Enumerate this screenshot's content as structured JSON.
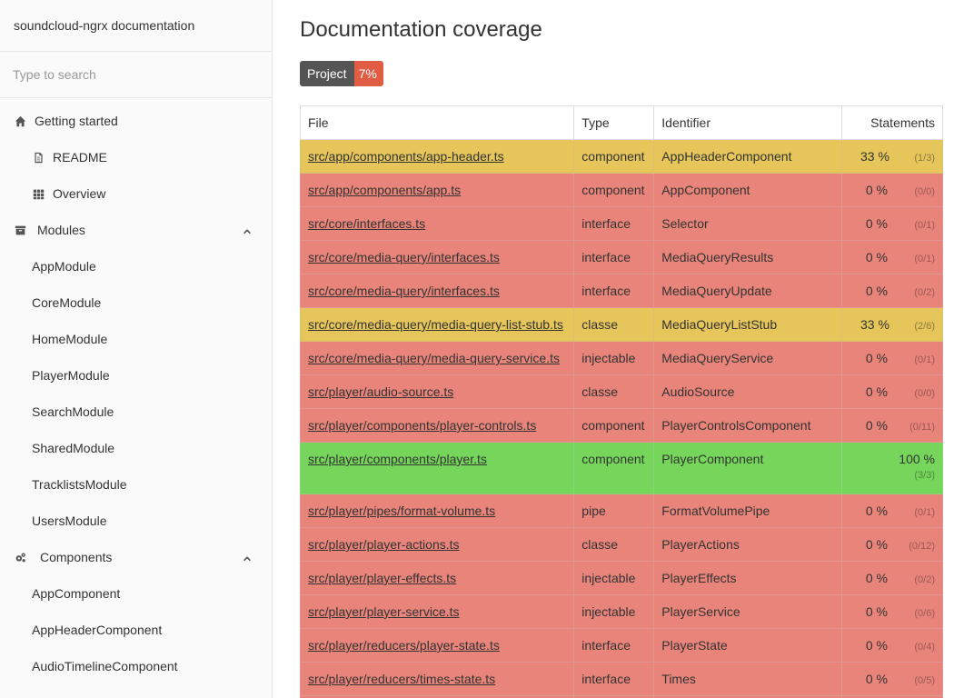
{
  "brand": "soundcloud-ngrx documentation",
  "search": {
    "placeholder": "Type to search"
  },
  "menu": {
    "getting_started": "Getting started",
    "readme": "README",
    "overview": "Overview",
    "modules": "Modules",
    "module_items": [
      "AppModule",
      "CoreModule",
      "HomeModule",
      "PlayerModule",
      "SearchModule",
      "SharedModule",
      "TracklistsModule",
      "UsersModule"
    ],
    "components": "Components",
    "component_items": [
      "AppComponent",
      "AppHeaderComponent",
      "AudioTimelineComponent"
    ]
  },
  "page": {
    "title": "Documentation coverage",
    "badge_label": "Project",
    "badge_value": "7%"
  },
  "table": {
    "headers": {
      "file": "File",
      "type": "Type",
      "identifier": "Identifier",
      "statements": "Statements"
    },
    "rows": [
      {
        "file": "src/app/components/app-header.ts",
        "type": "component",
        "identifier": "AppHeaderComponent",
        "pct": "33 %",
        "count": "(1/3)",
        "level": "med"
      },
      {
        "file": "src/app/components/app.ts",
        "type": "component",
        "identifier": "AppComponent",
        "pct": "0 %",
        "count": "(0/0)",
        "level": "low"
      },
      {
        "file": "src/core/interfaces.ts",
        "type": "interface",
        "identifier": "Selector",
        "pct": "0 %",
        "count": "(0/1)",
        "level": "low"
      },
      {
        "file": "src/core/media-query/interfaces.ts",
        "type": "interface",
        "identifier": "MediaQueryResults",
        "pct": "0 %",
        "count": "(0/1)",
        "level": "low"
      },
      {
        "file": "src/core/media-query/interfaces.ts",
        "type": "interface",
        "identifier": "MediaQueryUpdate",
        "pct": "0 %",
        "count": "(0/2)",
        "level": "low"
      },
      {
        "file": "src/core/media-query/media-query-list-stub.ts",
        "type": "classe",
        "identifier": "MediaQueryListStub",
        "pct": "33 %",
        "count": "(2/6)",
        "level": "med"
      },
      {
        "file": "src/core/media-query/media-query-service.ts",
        "type": "injectable",
        "identifier": "MediaQueryService",
        "pct": "0 %",
        "count": "(0/1)",
        "level": "low"
      },
      {
        "file": "src/player/audio-source.ts",
        "type": "classe",
        "identifier": "AudioSource",
        "pct": "0 %",
        "count": "(0/0)",
        "level": "low"
      },
      {
        "file": "src/player/components/player-controls.ts",
        "type": "component",
        "identifier": "PlayerControlsComponent",
        "pct": "0 %",
        "count": "(0/11)",
        "level": "low"
      },
      {
        "file": "src/player/components/player.ts",
        "type": "component",
        "identifier": "PlayerComponent",
        "pct": "100 %",
        "count": "(3/3)",
        "level": "good"
      },
      {
        "file": "src/player/pipes/format-volume.ts",
        "type": "pipe",
        "identifier": "FormatVolumePipe",
        "pct": "0 %",
        "count": "(0/1)",
        "level": "low"
      },
      {
        "file": "src/player/player-actions.ts",
        "type": "classe",
        "identifier": "PlayerActions",
        "pct": "0 %",
        "count": "(0/12)",
        "level": "low"
      },
      {
        "file": "src/player/player-effects.ts",
        "type": "injectable",
        "identifier": "PlayerEffects",
        "pct": "0 %",
        "count": "(0/2)",
        "level": "low"
      },
      {
        "file": "src/player/player-service.ts",
        "type": "injectable",
        "identifier": "PlayerService",
        "pct": "0 %",
        "count": "(0/6)",
        "level": "low"
      },
      {
        "file": "src/player/reducers/player-state.ts",
        "type": "interface",
        "identifier": "PlayerState",
        "pct": "0 %",
        "count": "(0/4)",
        "level": "low"
      },
      {
        "file": "src/player/reducers/times-state.ts",
        "type": "interface",
        "identifier": "Times",
        "pct": "0 %",
        "count": "(0/5)",
        "level": "low"
      },
      {
        "file": "",
        "type": "",
        "identifier": "",
        "pct": "",
        "count": "",
        "level": "low"
      }
    ]
  },
  "colors": {
    "low": "#e8847a",
    "med": "#e6c65a",
    "good": "#76d65b",
    "badge_red": "#e05d44"
  }
}
